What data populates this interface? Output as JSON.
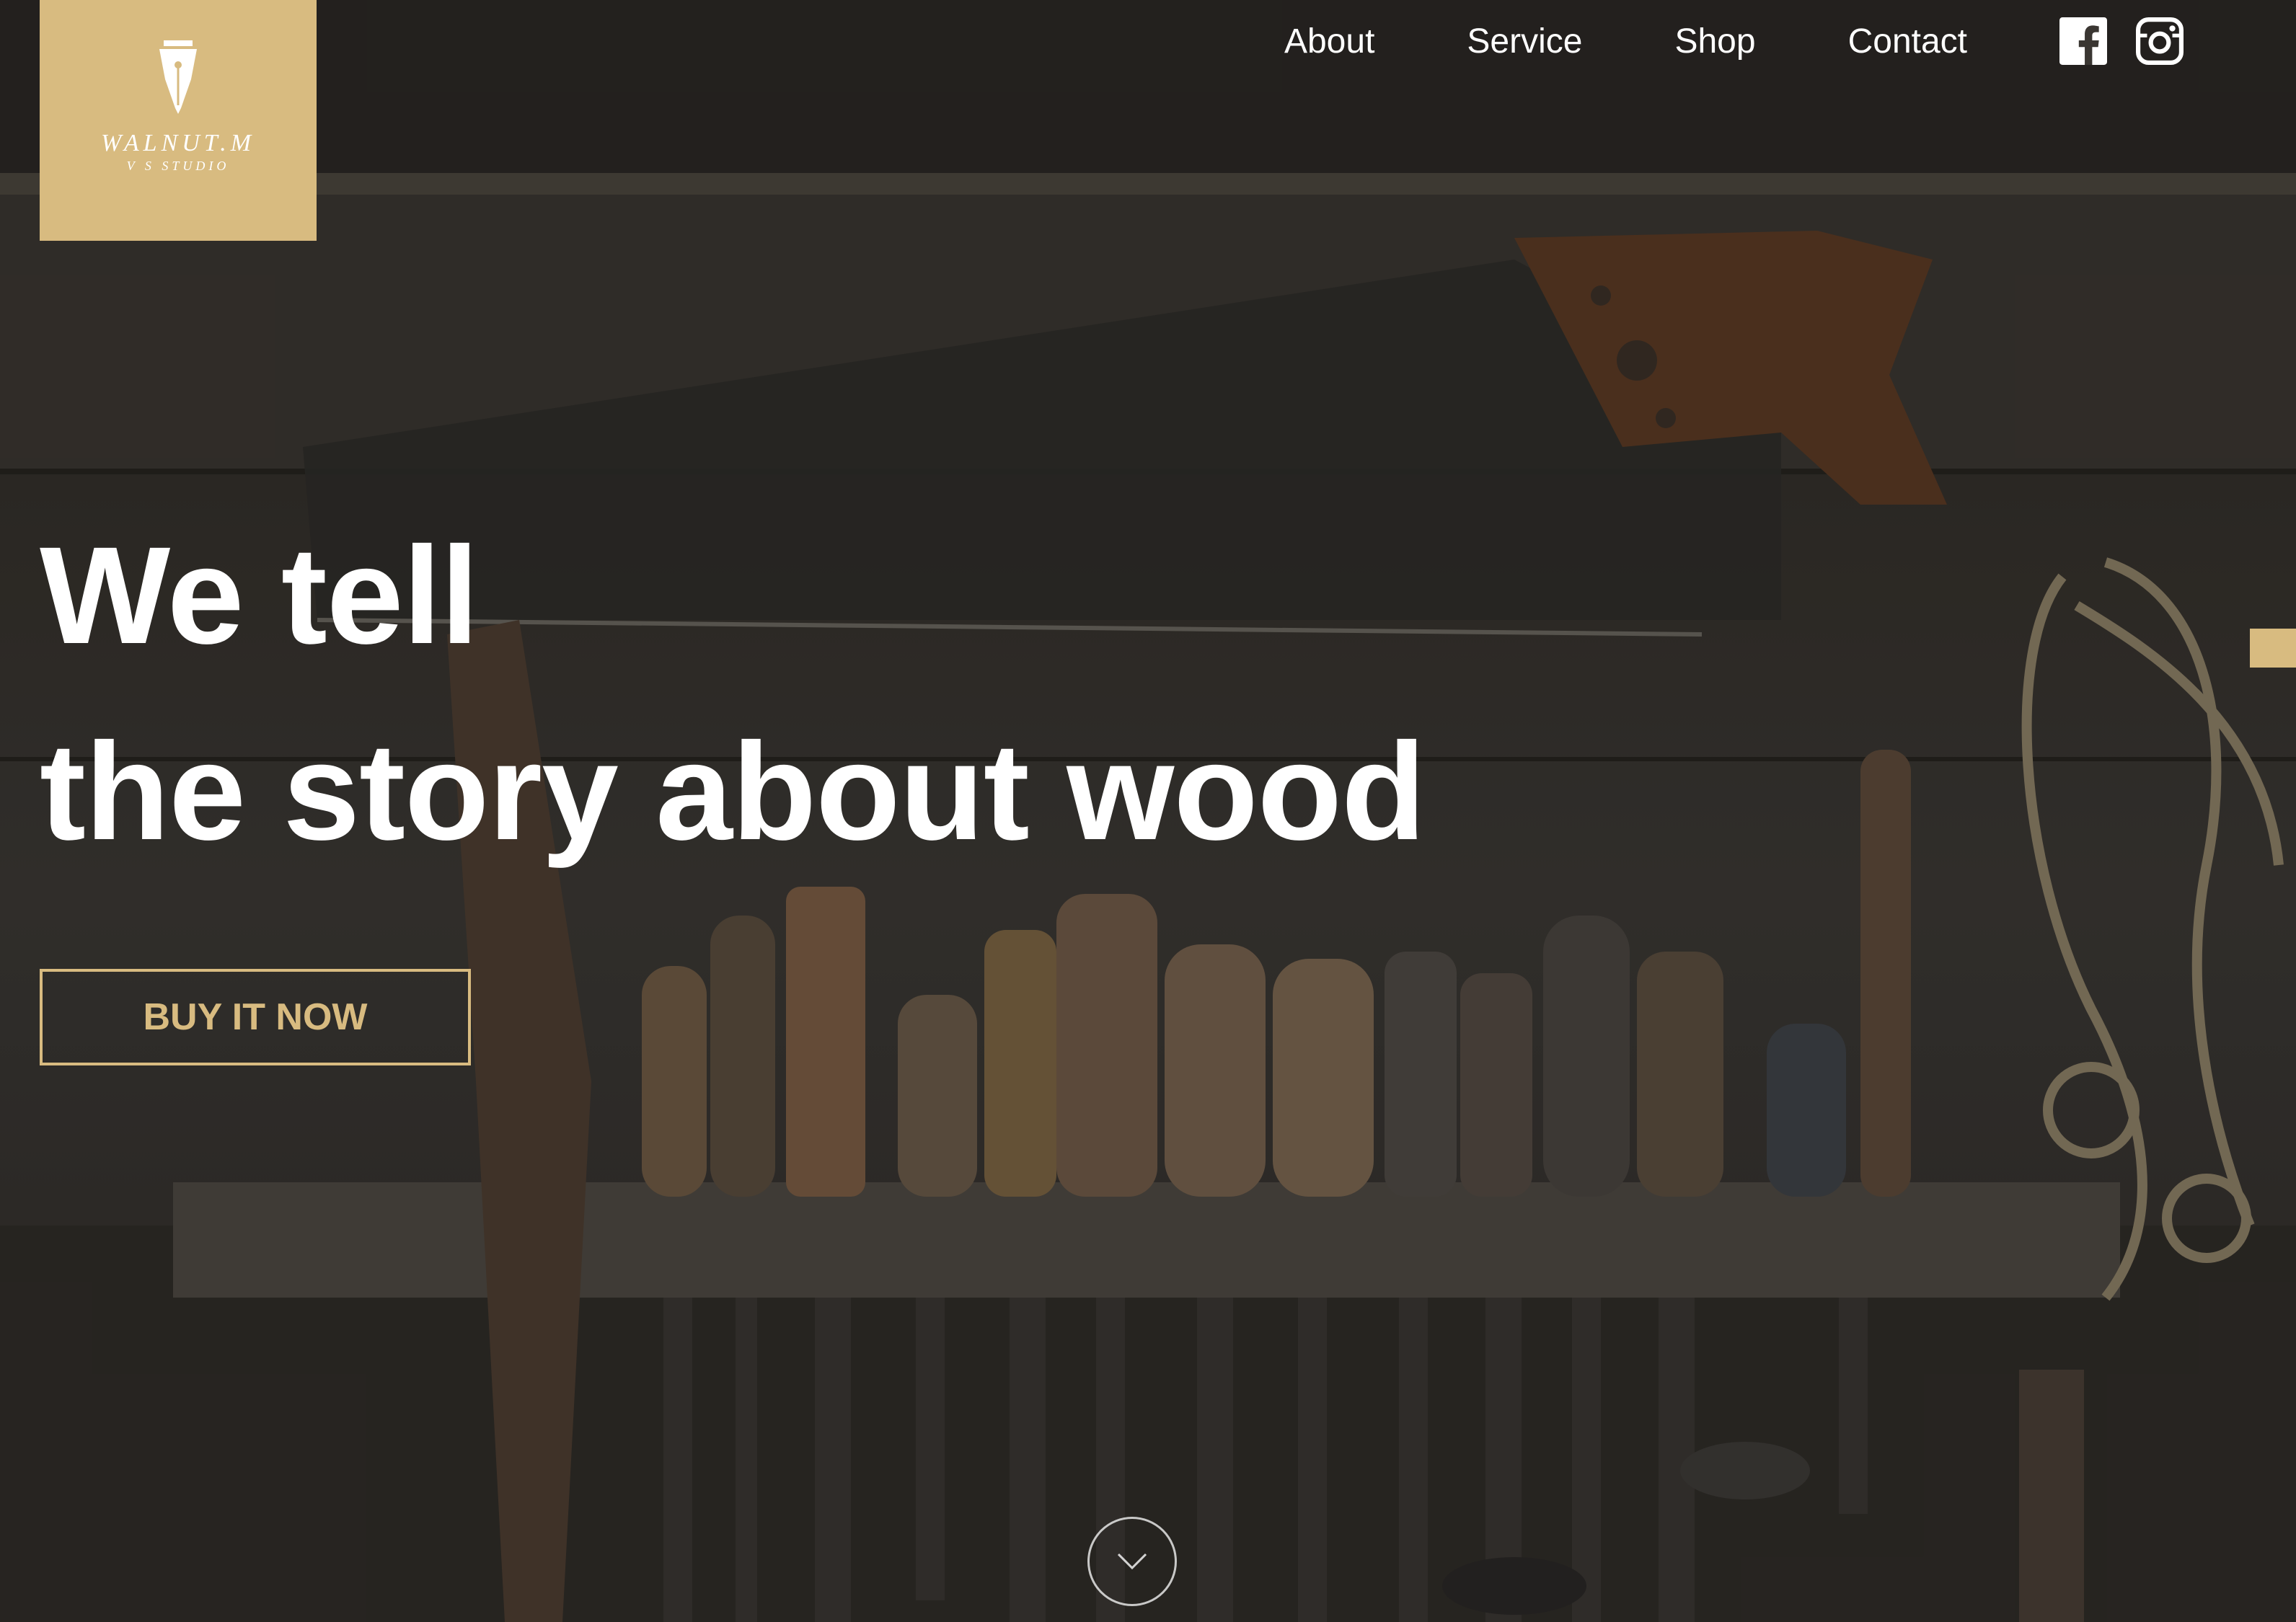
{
  "logo": {
    "brand": "WALNUT.M",
    "sub": "V S STUDIO"
  },
  "nav": {
    "items": [
      {
        "label": "About"
      },
      {
        "label": "Service"
      },
      {
        "label": "Shop"
      },
      {
        "label": "Contact"
      }
    ],
    "socials": [
      {
        "icon": "facebook-icon"
      },
      {
        "icon": "instagram-icon"
      }
    ]
  },
  "hero": {
    "headline_line1": "We tell",
    "headline_line2": "the story about wood",
    "cta_label": "BUY IT NOW"
  },
  "icons": {
    "scroll": "chevron-down-icon",
    "logo_mark": "pen-nib-icon"
  },
  "colors": {
    "accent": "#d8bb80",
    "text": "#ffffff",
    "background": "#2e2b28"
  }
}
